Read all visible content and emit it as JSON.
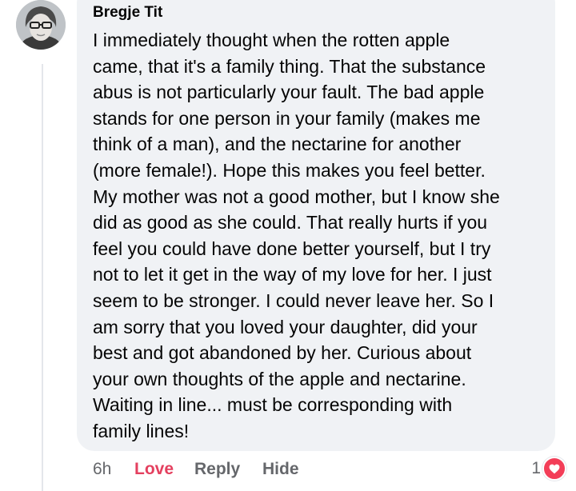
{
  "comment": {
    "author": "Bregje Tit",
    "text_lines": [
      "I immediately thought when the rotten apple",
      "came, that it's a family thing. That the substance",
      "abus is not particularly your fault. The bad apple",
      "stands for one person in your family (makes me",
      "think of a man), and the nectarine for another",
      "(more female!). Hope this makes you feel better.",
      "My mother was not a good mother, but I know she",
      "did as good as she could. That really hurts if you",
      "feel you could have done better yourself, but I try",
      "not to let it get in the way of my love for her. I just",
      "seem to be stronger. I could never leave her. So I",
      "am sorry that you loved your daughter, did your",
      "best and got abandoned by her. Curious about",
      "your own thoughts of the apple and nectarine.",
      "Waiting in line... must be corresponding with",
      "family lines!"
    ],
    "timestamp": "6h",
    "actions": {
      "love": "Love",
      "reply": "Reply",
      "hide": "Hide"
    },
    "reactions": {
      "count": "1",
      "icon": "heart-icon"
    }
  },
  "colors": {
    "bubble_bg": "#f0f2f5",
    "text": "#050505",
    "secondary_text": "#65676b",
    "love_accent": "#e4405f",
    "heart_badge": "#f33e58"
  }
}
